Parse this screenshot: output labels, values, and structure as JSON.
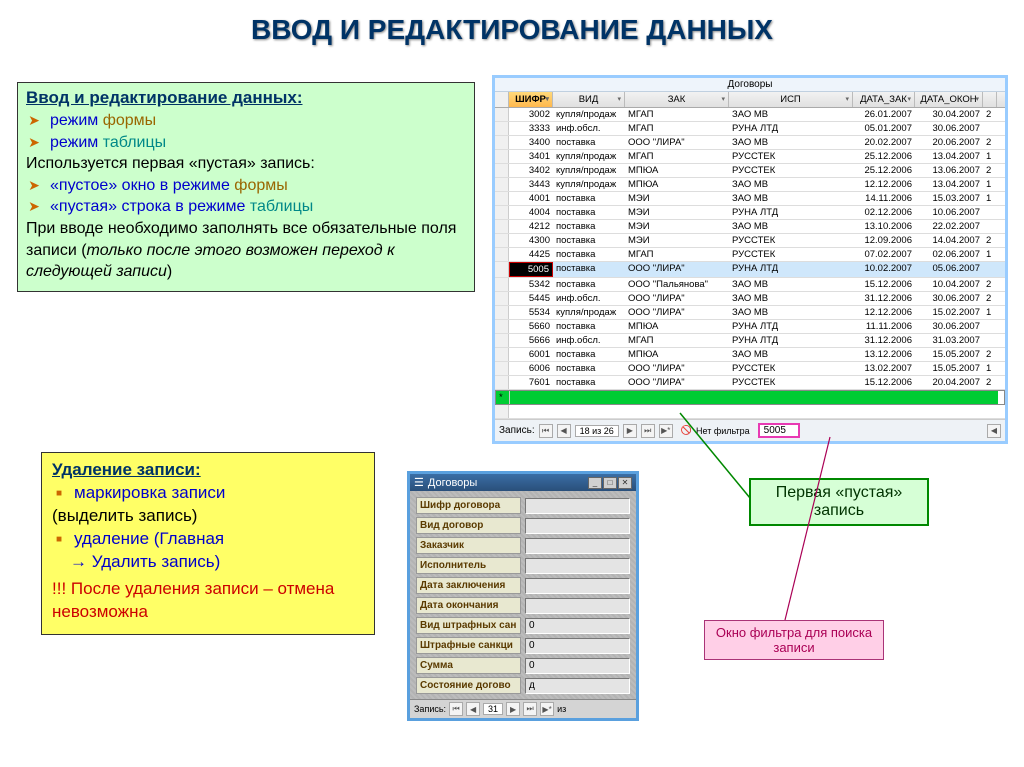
{
  "title": "ВВОД И РЕДАКТИРОВАНИЕ ДАННЫХ",
  "green": {
    "hdr": "Ввод и редактирование данных:",
    "b1a": "режим ",
    "b1b": "формы",
    "b2a": "режим ",
    "b2b": "таблицы",
    "p1": "Используется первая «пустая» запись:",
    "b3a": "«пустое» окно в режиме ",
    "b3b": "формы",
    "b4a": "«пустая» строка в режиме ",
    "b4b": "таблицы",
    "p2a": "При вводе необходимо заполнять все обязательные поля записи (",
    "p2b": "только после этого возможен переход к следующей записи",
    "p2c": ")"
  },
  "yellow": {
    "hdr": "Удаление записи:",
    "b1a": "маркировка записи",
    "b1b": "(выделить запись)",
    "b2a": "удаление (Главная",
    "b2b": "   →  Удалить запись)",
    "warn": "!!! После удаления записи – отмена невозможна"
  },
  "grid": {
    "title": "Договоры",
    "headers": [
      "ШИФР",
      "ВИД",
      "ЗАК",
      "ИСП",
      "ДАТА_ЗАК",
      "ДАТА_ОКОН"
    ],
    "rows": [
      [
        "3002",
        "купля/продаж",
        "МГАП",
        "ЗАО МВ",
        "26.01.2007",
        "30.04.2007",
        "2"
      ],
      [
        "3333",
        "инф.обсл.",
        "МГАП",
        "РУНА ЛТД",
        "05.01.2007",
        "30.06.2007",
        ""
      ],
      [
        "3400",
        "поставка",
        "ООО \"ЛИРА\"",
        "ЗАО МВ",
        "20.02.2007",
        "20.06.2007",
        "2"
      ],
      [
        "3401",
        "купля/продаж",
        "МГАП",
        "РУССТЕК",
        "25.12.2006",
        "13.04.2007",
        "1"
      ],
      [
        "3402",
        "купля/продаж",
        "МПЮА",
        "РУССТЕК",
        "25.12.2006",
        "13.06.2007",
        "2"
      ],
      [
        "3443",
        "купля/продаж",
        "МПЮА",
        "ЗАО МВ",
        "12.12.2006",
        "13.04.2007",
        "1"
      ],
      [
        "4001",
        "поставка",
        "МЭИ",
        "ЗАО МВ",
        "14.11.2006",
        "15.03.2007",
        "1"
      ],
      [
        "4004",
        "поставка",
        "МЭИ",
        "РУНА ЛТД",
        "02.12.2006",
        "10.06.2007",
        ""
      ],
      [
        "4212",
        "поставка",
        "МЭИ",
        "ЗАО МВ",
        "13.10.2006",
        "22.02.2007",
        ""
      ],
      [
        "4300",
        "поставка",
        "МЭИ",
        "РУССТЕК",
        "12.09.2006",
        "14.04.2007",
        "2"
      ],
      [
        "4425",
        "поставка",
        "МГАП",
        "РУССТЕК",
        "07.02.2007",
        "02.06.2007",
        "1"
      ],
      [
        "5005",
        "поставка",
        "ООО \"ЛИРА\"",
        "РУНА ЛТД",
        "10.02.2007",
        "05.06.2007",
        ""
      ],
      [
        "5342",
        "поставка",
        "ООО \"Пальянова\"",
        "ЗАО МВ",
        "15.12.2006",
        "10.04.2007",
        "2"
      ],
      [
        "5445",
        "инф.обсл.",
        "ООО \"ЛИРА\"",
        "ЗАО МВ",
        "31.12.2006",
        "30.06.2007",
        "2"
      ],
      [
        "5534",
        "купля/продаж",
        "ООО \"ЛИРА\"",
        "ЗАО МВ",
        "12.12.2006",
        "15.02.2007",
        "1"
      ],
      [
        "5660",
        "поставка",
        "МПЮА",
        "РУНА ЛТД",
        "11.11.2006",
        "30.06.2007",
        ""
      ],
      [
        "5666",
        "инф.обсл.",
        "МГАП",
        "РУНА ЛТД",
        "31.12.2006",
        "31.03.2007",
        ""
      ],
      [
        "6001",
        "поставка",
        "МПЮА",
        "ЗАО МВ",
        "13.12.2006",
        "15.05.2007",
        "2"
      ],
      [
        "6006",
        "поставка",
        "ООО \"ЛИРА\"",
        "РУССТЕК",
        "13.02.2007",
        "15.05.2007",
        "1"
      ],
      [
        "7601",
        "поставка",
        "ООО \"ЛИРА\"",
        "РУССТЕК",
        "15.12.2006",
        "20.04.2007",
        "2"
      ]
    ],
    "sel_index": 11,
    "nav": {
      "label": "Запись:",
      "pos": "18 из 26",
      "filter_label": "Нет фильтра",
      "filter_val": "5005"
    }
  },
  "form": {
    "title": "Договоры",
    "fields": [
      {
        "label": "Шифр договора",
        "val": ""
      },
      {
        "label": "Вид договор",
        "val": ""
      },
      {
        "label": "Заказчик",
        "val": ""
      },
      {
        "label": "Исполнитель",
        "val": ""
      },
      {
        "label": "Дата заключения",
        "val": ""
      },
      {
        "label": "Дата окончания",
        "val": ""
      },
      {
        "label": "Вид штрафных сан",
        "val": "0"
      },
      {
        "label": "Штрафные санкци",
        "val": "0"
      },
      {
        "label": "Сумма",
        "val": "0"
      },
      {
        "label": "Состояние догово",
        "val": "д"
      }
    ],
    "nav_label": "Запись:",
    "nav_pos": "31",
    "nav_of": "из"
  },
  "callouts": {
    "empty1": "Первая «пустая»",
    "empty2": "запись",
    "filter": "Окно фильтра для поиска записи"
  }
}
